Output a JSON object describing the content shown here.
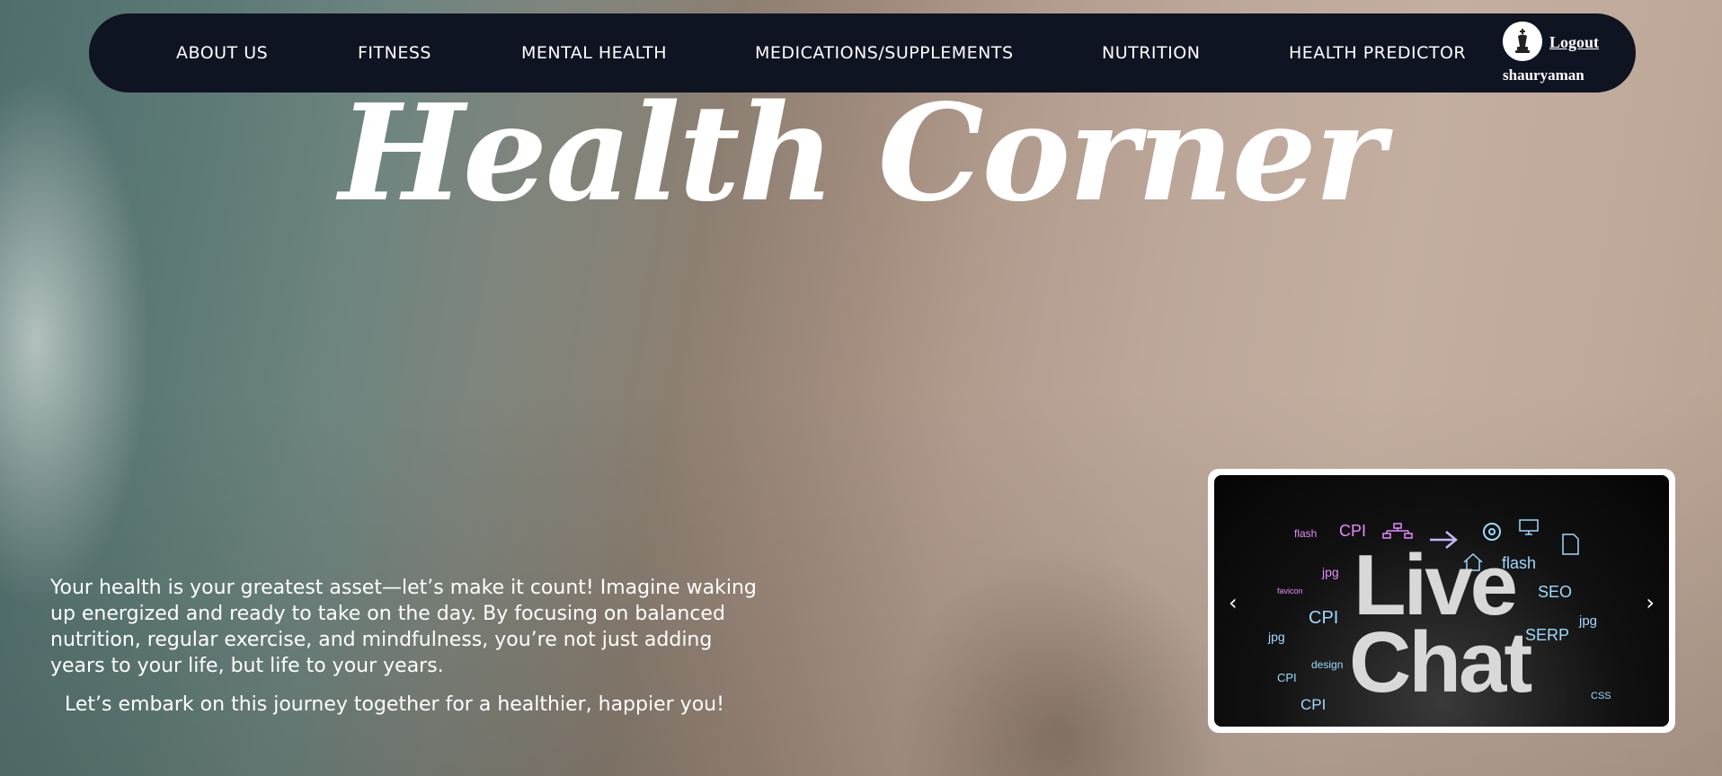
{
  "nav": {
    "items": [
      {
        "label": "ABOUT US"
      },
      {
        "label": "FITNESS"
      },
      {
        "label": "MENTAL HEALTH"
      },
      {
        "label": "MEDICATIONS/SUPPLEMENTS"
      },
      {
        "label": "NUTRITION"
      },
      {
        "label": "HEALTH PREDICTOR"
      }
    ],
    "logout_label": "Logout",
    "username": "shauryaman"
  },
  "hero": {
    "title": "Health Corner"
  },
  "intro": {
    "paragraph": "Your health is your greatest asset—let’s make it count! Imagine waking up energized and ready to take on the day. By focusing on balanced nutrition, regular exercise, and mindfulness, you’re not just adding years to your life, but life to your years.",
    "tagline": "Let’s embark on this journey together for a healthier, happier you!"
  },
  "carousel": {
    "prev_icon": "‹",
    "next_icon": "›",
    "image_title": "Live Chat",
    "words": [
      "flash",
      "CPI",
      "jpg",
      "SEO",
      "CPI",
      "SERP",
      "jpg",
      "design",
      "CPI",
      "CPI",
      "CSS",
      "flash",
      "jpg",
      "favicon"
    ]
  },
  "colors": {
    "navbar_bg": "#0f1423",
    "text": "#ffffff",
    "neon_pink": "#e58cff",
    "neon_blue": "#9fd9ff"
  }
}
